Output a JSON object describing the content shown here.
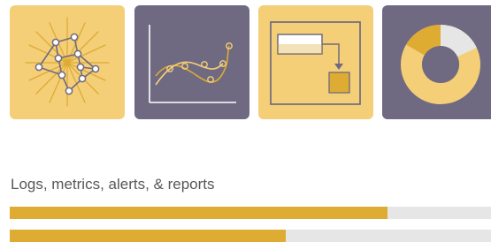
{
  "colors": {
    "tile_gold": "#f4cf78",
    "tile_slate": "#6f6a81",
    "accent": "#deab33",
    "light_gray": "#e6e6e6",
    "node": "#ffffff",
    "node_stroke": "#6f6a81",
    "caption": "#585858"
  },
  "tiles": [
    {
      "icon": "network-graph-icon"
    },
    {
      "icon": "line-chart-icon"
    },
    {
      "icon": "flow-diagram-icon"
    },
    {
      "icon": "donut-chart-icon"
    }
  ],
  "caption": "Logs, metrics, alerts, & reports",
  "progress_bars": [
    {
      "fraction": 0.785
    },
    {
      "fraction": 0.573
    }
  ]
}
